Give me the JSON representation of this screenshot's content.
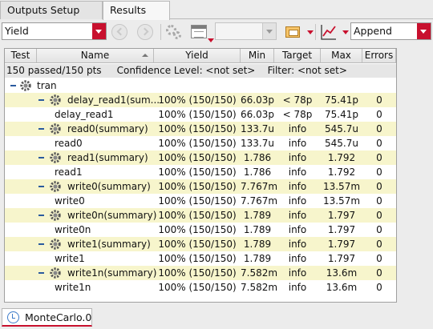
{
  "tabs": [
    {
      "label": "Outputs Setup",
      "active": false
    },
    {
      "label": "Results",
      "active": true
    }
  ],
  "toolbar": {
    "view_select": "Yield",
    "blank_select": "",
    "append_select": "Append"
  },
  "table": {
    "columns": [
      "Test",
      "Name",
      "Yield",
      "Min",
      "Target",
      "Max",
      "Errors"
    ],
    "summary": "150 passed/150 pts     Confidence Level: <not set>    Filter: <not set>",
    "test": "tran",
    "rows": [
      {
        "name": "delay_read1(sum...",
        "yield": "100% (150/150)",
        "min": "66.03p",
        "target": "< 78p",
        "max": "75.41p",
        "errors": "0",
        "summary": true
      },
      {
        "name": "delay_read1",
        "yield": "100% (150/150)",
        "min": "66.03p",
        "target": "< 78p",
        "max": "75.41p",
        "errors": "0",
        "summary": false
      },
      {
        "name": "read0(summary)",
        "yield": "100% (150/150)",
        "min": "133.7u",
        "target": "info",
        "max": "545.7u",
        "errors": "0",
        "summary": true
      },
      {
        "name": "read0",
        "yield": "100% (150/150)",
        "min": "133.7u",
        "target": "info",
        "max": "545.7u",
        "errors": "0",
        "summary": false
      },
      {
        "name": "read1(summary)",
        "yield": "100% (150/150)",
        "min": "1.786",
        "target": "info",
        "max": "1.792",
        "errors": "0",
        "summary": true
      },
      {
        "name": "read1",
        "yield": "100% (150/150)",
        "min": "1.786",
        "target": "info",
        "max": "1.792",
        "errors": "0",
        "summary": false
      },
      {
        "name": "write0(summary)",
        "yield": "100% (150/150)",
        "min": "7.767m",
        "target": "info",
        "max": "13.57m",
        "errors": "0",
        "summary": true
      },
      {
        "name": "write0",
        "yield": "100% (150/150)",
        "min": "7.767m",
        "target": "info",
        "max": "13.57m",
        "errors": "0",
        "summary": false
      },
      {
        "name": "write0n(summary)",
        "yield": "100% (150/150)",
        "min": "1.789",
        "target": "info",
        "max": "1.797",
        "errors": "0",
        "summary": true
      },
      {
        "name": "write0n",
        "yield": "100% (150/150)",
        "min": "1.789",
        "target": "info",
        "max": "1.797",
        "errors": "0",
        "summary": false
      },
      {
        "name": "write1(summary)",
        "yield": "100% (150/150)",
        "min": "1.789",
        "target": "info",
        "max": "1.797",
        "errors": "0",
        "summary": true
      },
      {
        "name": "write1",
        "yield": "100% (150/150)",
        "min": "1.789",
        "target": "info",
        "max": "1.797",
        "errors": "0",
        "summary": false
      },
      {
        "name": "write1n(summary)",
        "yield": "100% (150/150)",
        "min": "7.582m",
        "target": "info",
        "max": "13.6m",
        "errors": "0",
        "summary": true
      },
      {
        "name": "write1n",
        "yield": "100% (150/150)",
        "min": "7.582m",
        "target": "info",
        "max": "13.6m",
        "errors": "0",
        "summary": false
      }
    ]
  },
  "bottom_tab": {
    "label": "MonteCarlo.0"
  },
  "colors": {
    "accent_red": "#c8102e",
    "summary_row": "#f7f5cc",
    "tree_blue": "#2a5a9e"
  },
  "icons": {
    "gear": "gear-icon",
    "minus": "collapse-minus-icon",
    "clock": "history-clock-icon"
  }
}
